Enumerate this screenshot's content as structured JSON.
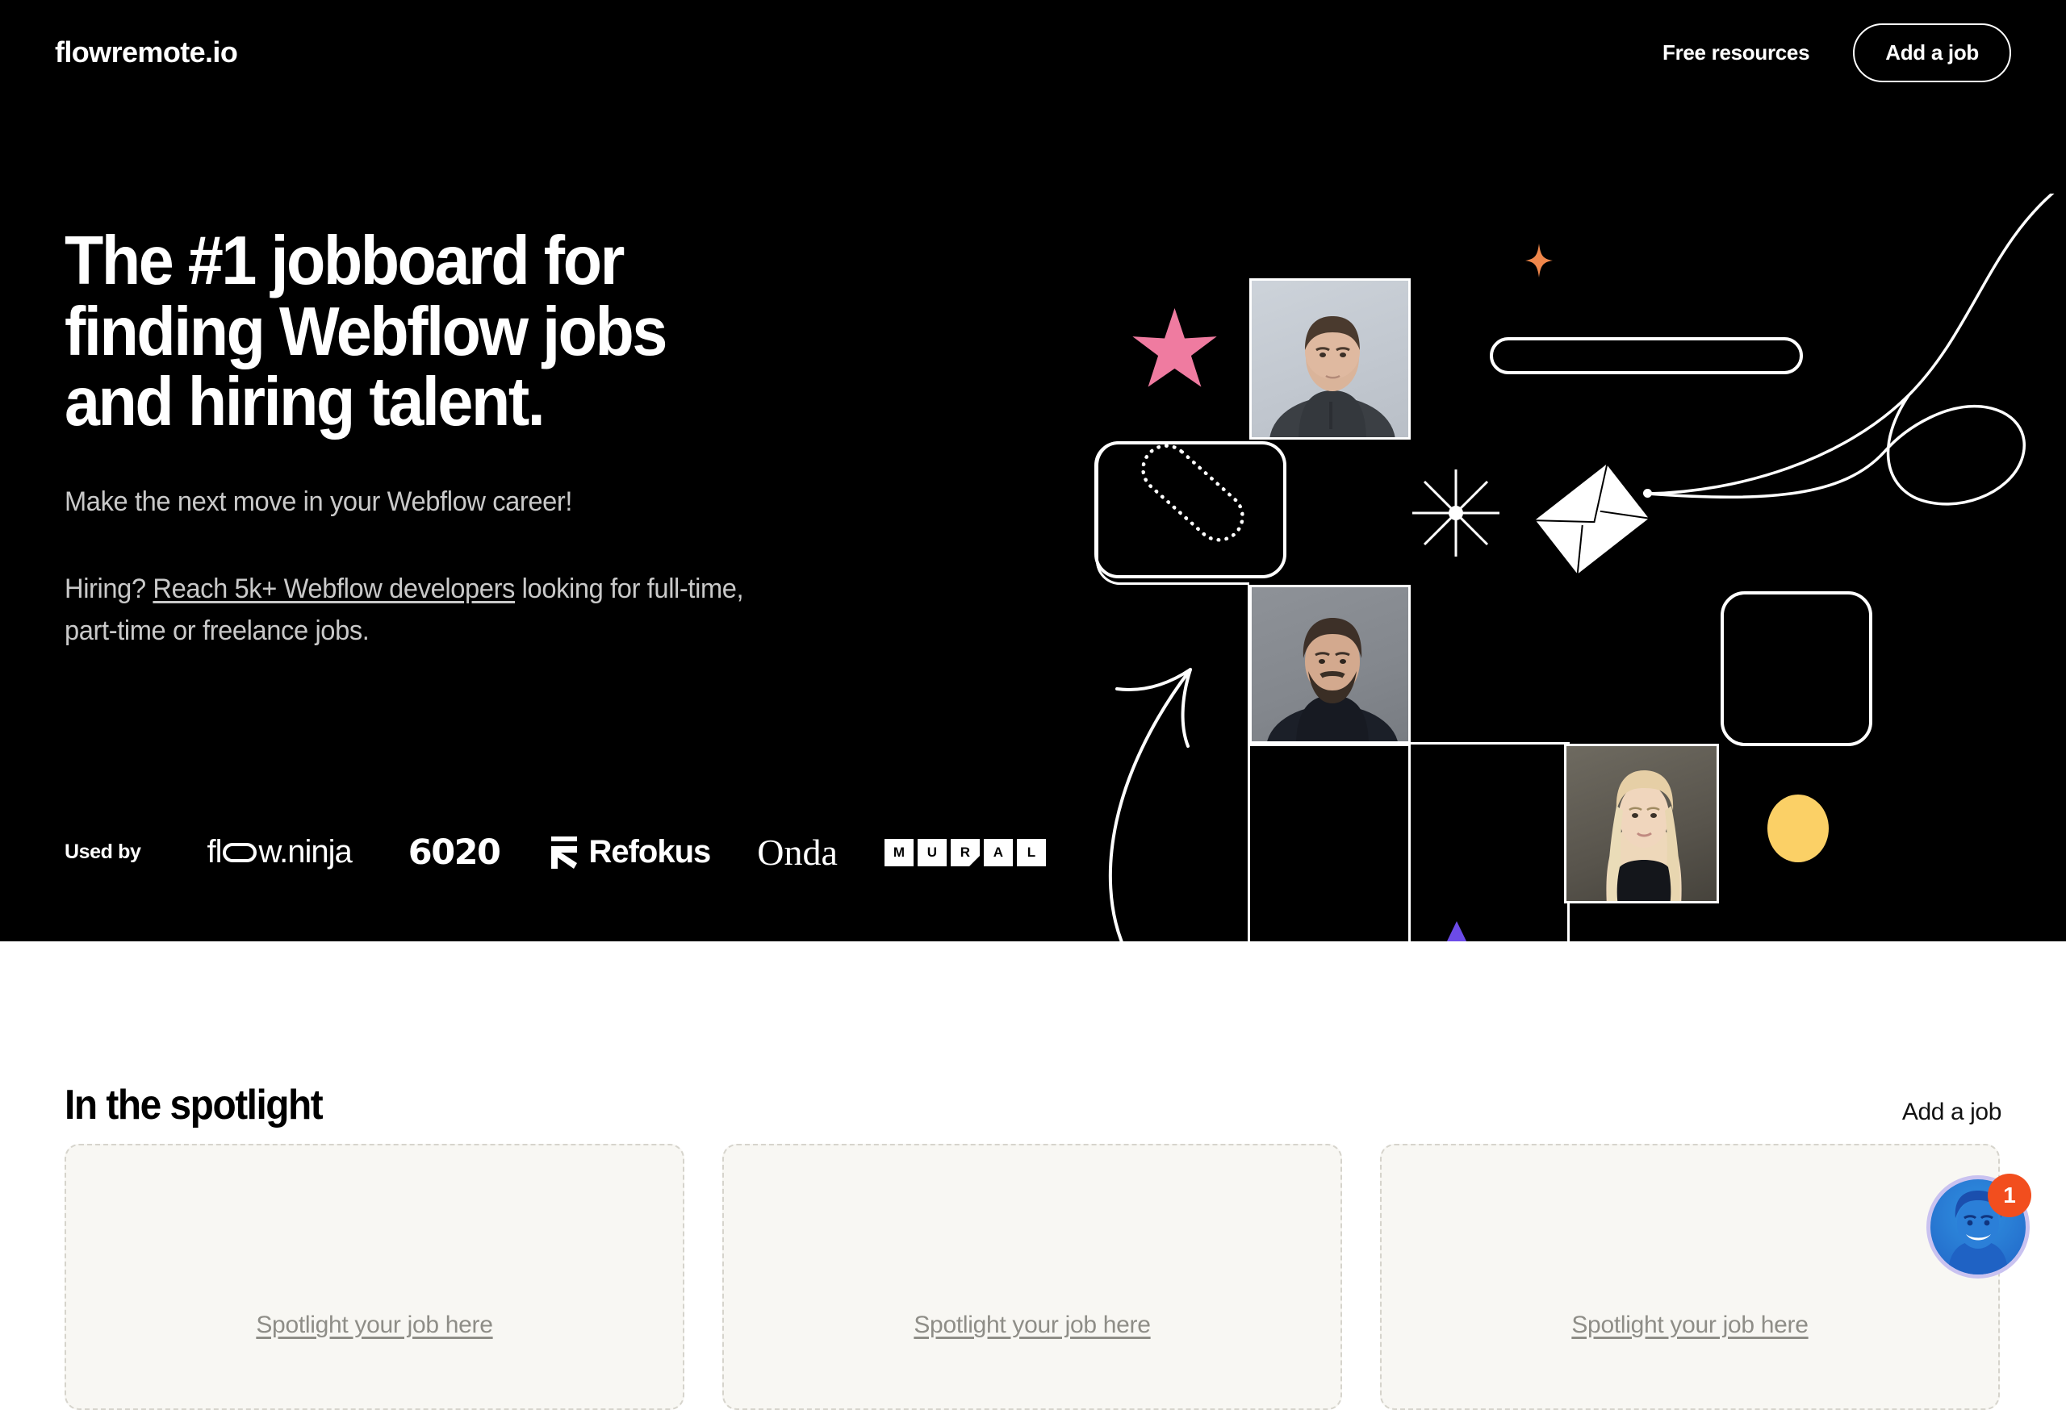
{
  "nav": {
    "logo": "flowremote.io",
    "free_resources_label": "Free resources",
    "add_job_label": "Add a job"
  },
  "hero": {
    "headline": "The #1 jobboard for\nfinding Webflow jobs\nand hiring talent.",
    "sub_line_1": "Make the next move in your Webflow career!",
    "sub_line_2_before": "Hiring? ",
    "sub_line_2_link": "Reach 5k+ Webflow developers",
    "sub_line_2_after": " looking for full-time, part-time or freelance jobs.",
    "background_color": "#000000",
    "text_color": "#ffffff",
    "subtext_color": "#c9c9c9"
  },
  "used_by": {
    "label": "Used by",
    "brands": [
      {
        "name": "flow.ninja",
        "id": "flow-ninja"
      },
      {
        "name": "6020",
        "id": "sixty-twenty"
      },
      {
        "name": "Refokus",
        "id": "refokus"
      },
      {
        "name": "Onda",
        "id": "onda"
      },
      {
        "name": "MURAL",
        "id": "mural",
        "letters": [
          "M",
          "U",
          "R",
          "A",
          "L"
        ]
      }
    ]
  },
  "art": {
    "colors": {
      "pink_star": "#EF7BA0",
      "orange_sparkle": "#F0874B",
      "yellow_ellipse": "#FBD066",
      "purple_triangle": "#6C4BE8",
      "outline": "#ffffff"
    },
    "shapes": [
      "pink-six-point-star",
      "orange-four-point-sparkle",
      "white-pill-outline",
      "rounded-square-with-dotted-oval",
      "eight-ray-starburst",
      "envelope",
      "curved-arrow",
      "swirl-line",
      "yellow-ellipse",
      "purple-triangle"
    ],
    "photos": [
      "portrait-young-man",
      "portrait-bearded-man",
      "portrait-blonde-woman"
    ]
  },
  "spotlight": {
    "title": "In the spotlight",
    "add_job_label": "Add a job",
    "cards": [
      {
        "link_label": "Spotlight your job here"
      },
      {
        "link_label": "Spotlight your job here"
      },
      {
        "link_label": "Spotlight your job here"
      }
    ],
    "card_background": "#F8F7F3",
    "card_border": "#d6d4cc"
  },
  "chat_widget": {
    "badge_count": "1",
    "badge_color": "#F24E1E"
  }
}
